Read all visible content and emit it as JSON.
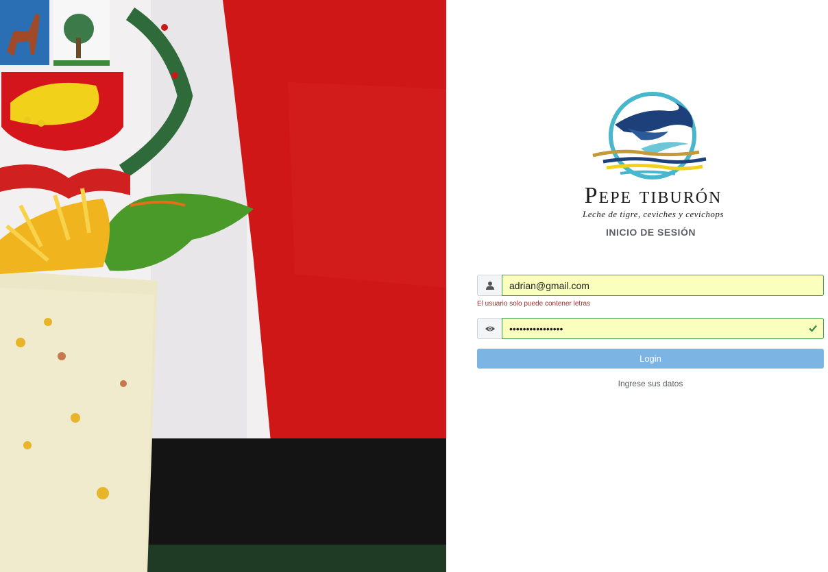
{
  "brand": {
    "name": "Pepe tiburón",
    "tagline": "Leche de tigre, ceviches y cevichops"
  },
  "login": {
    "title": "INICIO DE SESIÓN",
    "username_value": "adrian@gmail.com",
    "username_error": "El usuario solo puede contener letras",
    "password_value": "••••••••••••••••",
    "button_label": "Login",
    "hint": "Ingrese sus datos"
  },
  "icons": {
    "username": "user-icon",
    "password": "eye-icon",
    "valid": "checkmark-icon"
  },
  "colors": {
    "accent_button": "#7cb4e4",
    "valid_border": "#3f9a53",
    "error_text": "#a6262a",
    "autofill_bg": "#faffbd"
  }
}
